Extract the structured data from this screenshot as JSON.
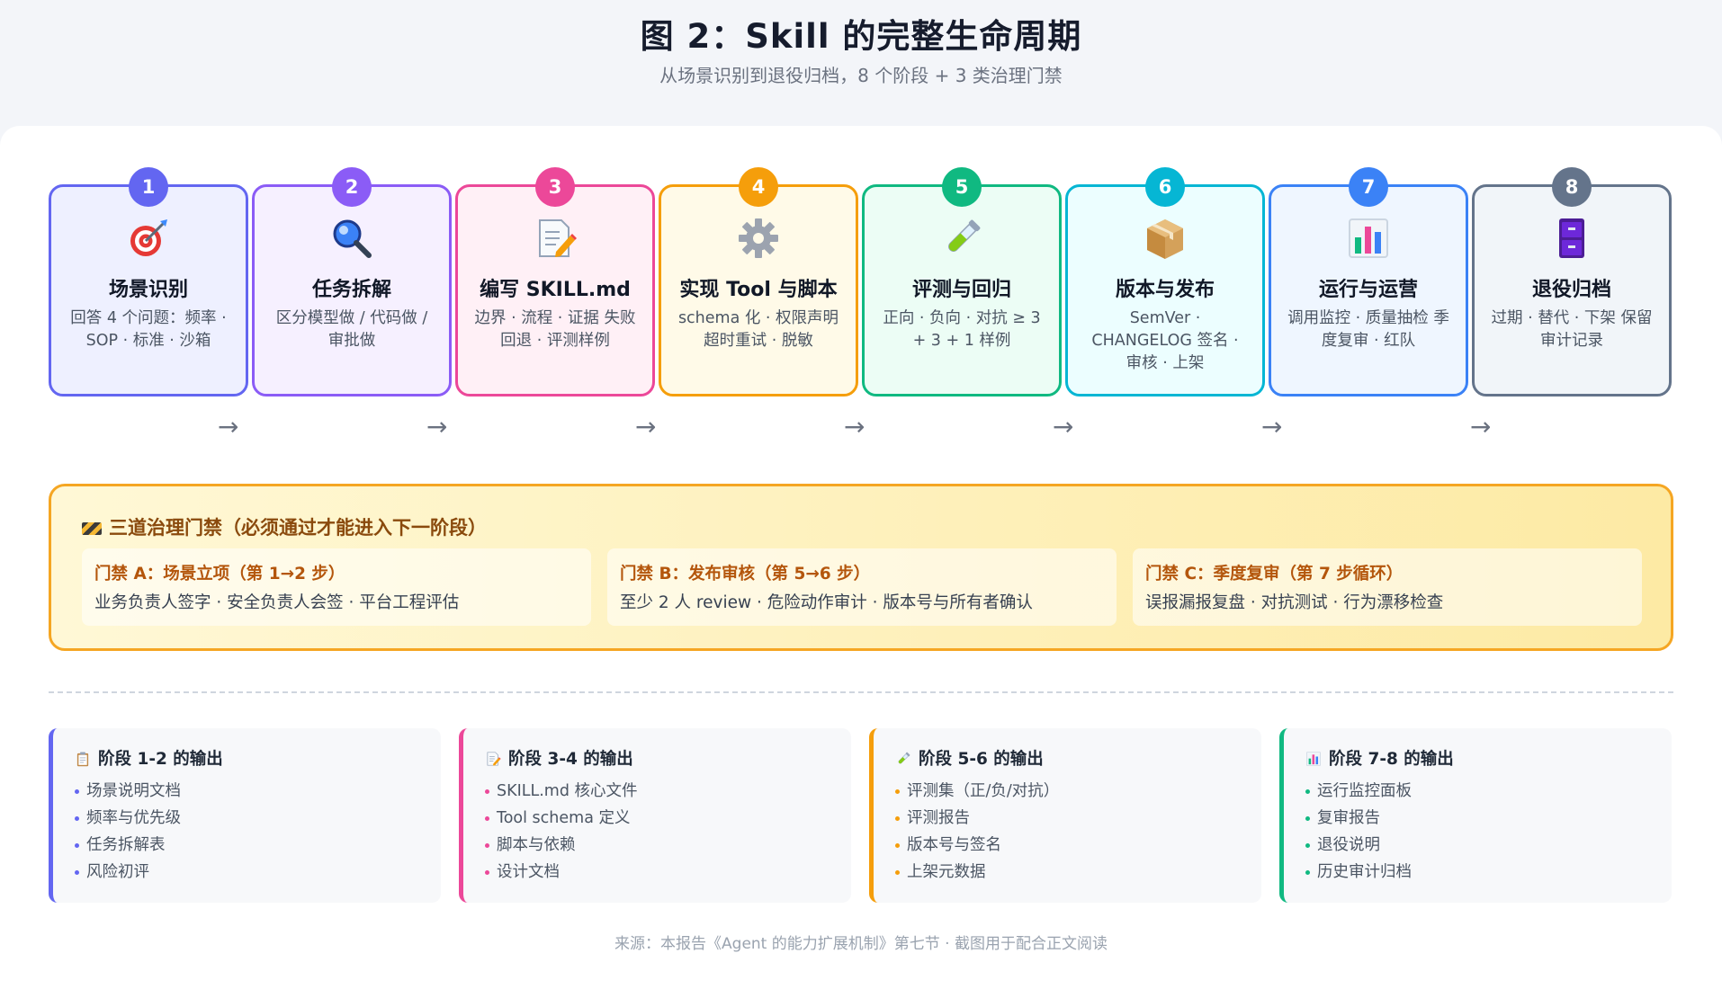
{
  "header": {
    "title": "图 2：Skill 的完整生命周期",
    "subtitle": "从场景识别到退役归档，8 个阶段 + 3 类治理门禁"
  },
  "stages": [
    {
      "num": "1",
      "title": "场景识别",
      "desc": "回答 4 个问题：频率 · SOP · 标准 · 沙箱",
      "color": "#6366f1",
      "bg": "#eef0ff",
      "icon": "target-icon"
    },
    {
      "num": "2",
      "title": "任务拆解",
      "desc": "区分模型做 / 代码做 / 审批做",
      "color": "#8b5cf6",
      "bg": "#f6f0ff",
      "icon": "magnifier-icon"
    },
    {
      "num": "3",
      "title": "编写 SKILL.md",
      "desc": "边界 · 流程 · 证据 失败回退 · 评测样例",
      "color": "#ec4899",
      "bg": "#fff0f6",
      "icon": "memo-icon"
    },
    {
      "num": "4",
      "title": "实现 Tool 与脚本",
      "desc": "schema 化 · 权限声明 超时重试 · 脱敏",
      "color": "#f59e0b",
      "bg": "#fffae8",
      "icon": "gear-icon"
    },
    {
      "num": "5",
      "title": "评测与回归",
      "desc": "正向 · 负向 · 对抗 ≥ 3 + 3 + 1 样例",
      "color": "#10b981",
      "bg": "#ecfdf5",
      "icon": "test-tube-icon"
    },
    {
      "num": "6",
      "title": "版本与发布",
      "desc": "SemVer · CHANGELOG 签名 · 审核 · 上架",
      "color": "#06b6d4",
      "bg": "#ecfeff",
      "icon": "package-icon"
    },
    {
      "num": "7",
      "title": "运行与运营",
      "desc": "调用监控 · 质量抽检 季度复审 · 红队",
      "color": "#3b82f6",
      "bg": "#eff6ff",
      "icon": "bar-chart-icon"
    },
    {
      "num": "8",
      "title": "退役归档",
      "desc": "过期 · 替代 · 下架 保留审计记录",
      "color": "#64748b",
      "bg": "#f1f5f9",
      "icon": "file-cabinet-icon"
    }
  ],
  "arrow_glyph": "→",
  "gates": {
    "title": "三道治理门禁（必须通过才能进入下一阶段）",
    "items": [
      {
        "title": "门禁 A：场景立项（第 1→2 步）",
        "desc": "业务负责人签字 · 安全负责人会签 · 平台工程评估"
      },
      {
        "title": "门禁 B：发布审核（第 5→6 步）",
        "desc": "至少 2 人 review · 危险动作审计 · 版本号与所有者确认"
      },
      {
        "title": "门禁 C：季度复审（第 7 步循环）",
        "desc": "误报漏报复盘 · 对抗测试 · 行为漂移检查"
      }
    ]
  },
  "outputs": [
    {
      "title": "阶段 1-2 的输出",
      "color": "#6366f1",
      "icon": "clipboard-icon",
      "items": [
        "场景说明文档",
        "频率与优先级",
        "任务拆解表",
        "风险初评"
      ]
    },
    {
      "title": "阶段 3-4 的输出",
      "color": "#ec4899",
      "icon": "memo-icon",
      "items": [
        "SKILL.md 核心文件",
        "Tool schema 定义",
        "脚本与依赖",
        "设计文档"
      ]
    },
    {
      "title": "阶段 5-6 的输出",
      "color": "#f59e0b",
      "icon": "test-tube-icon",
      "items": [
        "评测集（正/负/对抗）",
        "评测报告",
        "版本号与签名",
        "上架元数据"
      ]
    },
    {
      "title": "阶段 7-8 的输出",
      "color": "#10b981",
      "icon": "bar-chart-icon",
      "items": [
        "运行监控面板",
        "复审报告",
        "退役说明",
        "历史审计归档"
      ]
    }
  ],
  "footer": "来源：本报告《Agent 的能力扩展机制》第七节 · 截图用于配合正文阅读"
}
